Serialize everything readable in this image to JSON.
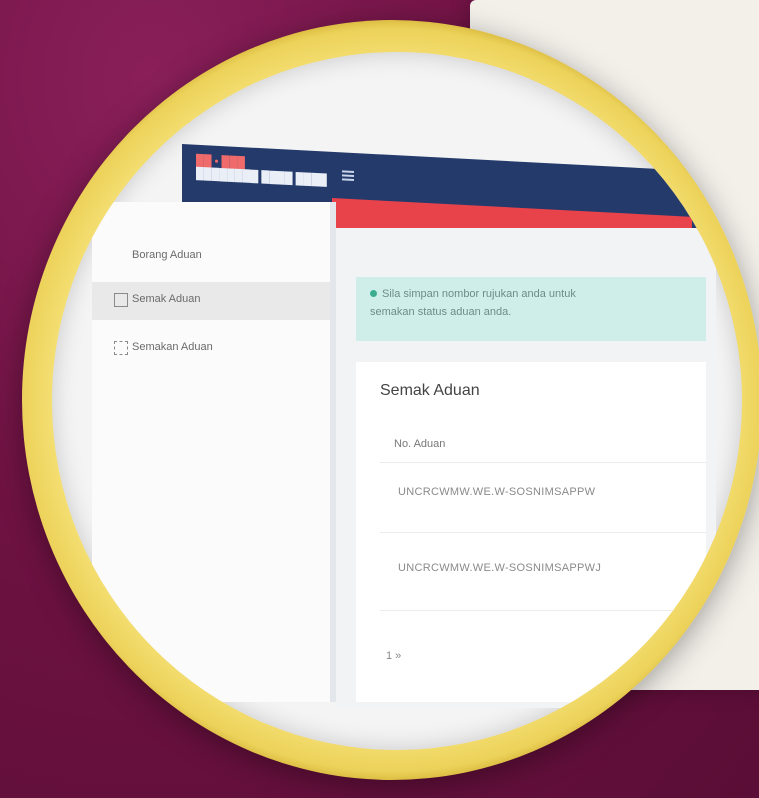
{
  "app": {
    "brand_line1": "██ • ███",
    "brand_line2": "████████ ████ ████"
  },
  "sidebar": {
    "items": [
      {
        "label": "Borang Aduan",
        "active": false
      },
      {
        "label": "Semak Aduan",
        "active": true
      },
      {
        "label": "Semakan Aduan",
        "active": false
      }
    ]
  },
  "alert": {
    "line1": "Sila simpan nombor rujukan anda untuk",
    "line2": "semakan status aduan anda."
  },
  "card": {
    "title": "Semak Aduan",
    "column_header": "No. Aduan",
    "rows": [
      "UNCRCWMW.WE.W-SOSNIMSAPPW",
      "UNCRCWMW.WE.W-SOSNIMSAPPWJ"
    ],
    "pager": "1 »"
  },
  "colors": {
    "topbar": "#233a6b",
    "accent_red": "#e8424a",
    "alert_bg": "#cfeeea",
    "frame_gold": "#f2d95c",
    "background": "#6e1242"
  }
}
